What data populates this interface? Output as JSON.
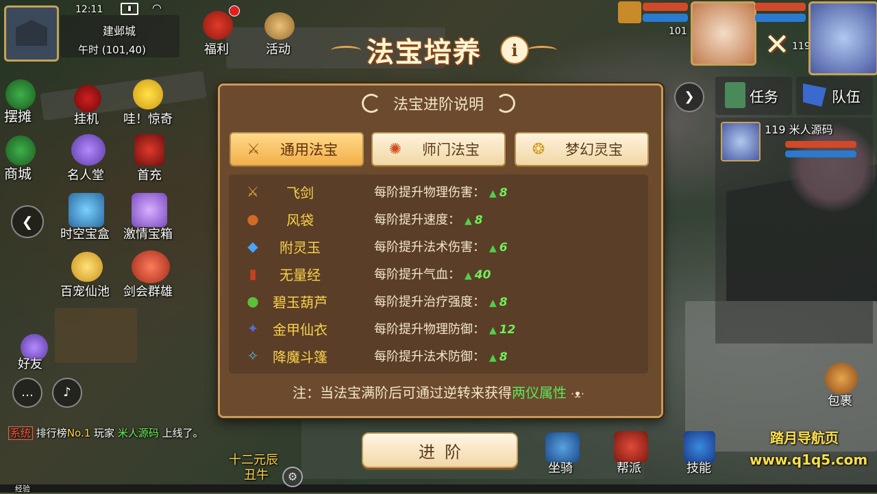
{
  "status": {
    "time": "12:11",
    "location": "建邺城",
    "time_coords": "午时 (101,40)"
  },
  "top_menu": {
    "welfare": "福利",
    "activity": "活动"
  },
  "left_menu": [
    {
      "label": "摆摊"
    },
    {
      "label": "挂机"
    },
    {
      "label": "哇！惊奇"
    },
    {
      "label": "商城"
    },
    {
      "label": "名人堂"
    },
    {
      "label": "首充"
    },
    {
      "label": "时空宝盒"
    },
    {
      "label": "激情宝箱"
    },
    {
      "label": "百宠仙池"
    },
    {
      "label": "剑会群雄"
    },
    {
      "label": "好友"
    }
  ],
  "right_menu": {
    "task": "任务",
    "team": "队伍",
    "bag": "包裹"
  },
  "hud_levels": {
    "left": "101",
    "right": "119"
  },
  "team_member": {
    "level_name": "119 米人源码"
  },
  "chat": {
    "tag": "系统",
    "line_prefix": "排行榜",
    "line_rank": "No.1",
    "line_mid": "玩家",
    "line_player": "米人源码",
    "line_suffix": "上线了。"
  },
  "bottom_menu": {
    "mount": "坐骑",
    "guild": "帮派",
    "skill": "技能",
    "zodiac": "十二元辰",
    "zodiac_sub": "丑牛",
    "exp": "经验"
  },
  "watermark": {
    "name": "踏月导航页",
    "url": "www.q1q5.com"
  },
  "dialog": {
    "title": "法宝培养",
    "info_label": "i",
    "close_label": "✕",
    "subtitle": "法宝进阶说明",
    "tabs": [
      {
        "label": "通用法宝",
        "icon": "crossed-swords-icon",
        "glyph": "⚔",
        "active": true
      },
      {
        "label": "师门法宝",
        "icon": "bell-charm-icon",
        "glyph": "✺",
        "active": false
      },
      {
        "label": "梦幻灵宝",
        "icon": "gold-ring-icon",
        "glyph": "❂",
        "active": false
      }
    ],
    "treasures": [
      {
        "name": "飞剑",
        "desc": "每阶提升物理伤害：",
        "value": "8",
        "glyph": "⚔",
        "color": "#d9a441"
      },
      {
        "name": "风袋",
        "desc": "每阶提升速度：",
        "value": "8",
        "glyph": "●",
        "color": "#d06a24"
      },
      {
        "name": "附灵玉",
        "desc": "每阶提升法术伤害：",
        "value": "6",
        "glyph": "◆",
        "color": "#4aa3ff"
      },
      {
        "name": "无量经",
        "desc": "每阶提升气血：",
        "value": "40",
        "glyph": "▮",
        "color": "#c8401f"
      },
      {
        "name": "碧玉葫芦",
        "desc": "每阶提升治疗强度：",
        "value": "8",
        "glyph": "●",
        "color": "#5fbf3a"
      },
      {
        "name": "金甲仙衣",
        "desc": "每阶提升物理防御：",
        "value": "12",
        "glyph": "✦",
        "color": "#5070d8"
      },
      {
        "name": "降魔斗篷",
        "desc": "每阶提升法术防御：",
        "value": "8",
        "glyph": "✧",
        "color": "#58b8d8"
      }
    ],
    "note_prefix": "注：当法宝满阶后可通过逆转来获得",
    "note_highlight": "两仪属性",
    "advance_button": "进阶"
  },
  "colors": {
    "panel": "#6b4a2e",
    "gold_text": "#f8d24a",
    "green": "#6ef05a"
  }
}
